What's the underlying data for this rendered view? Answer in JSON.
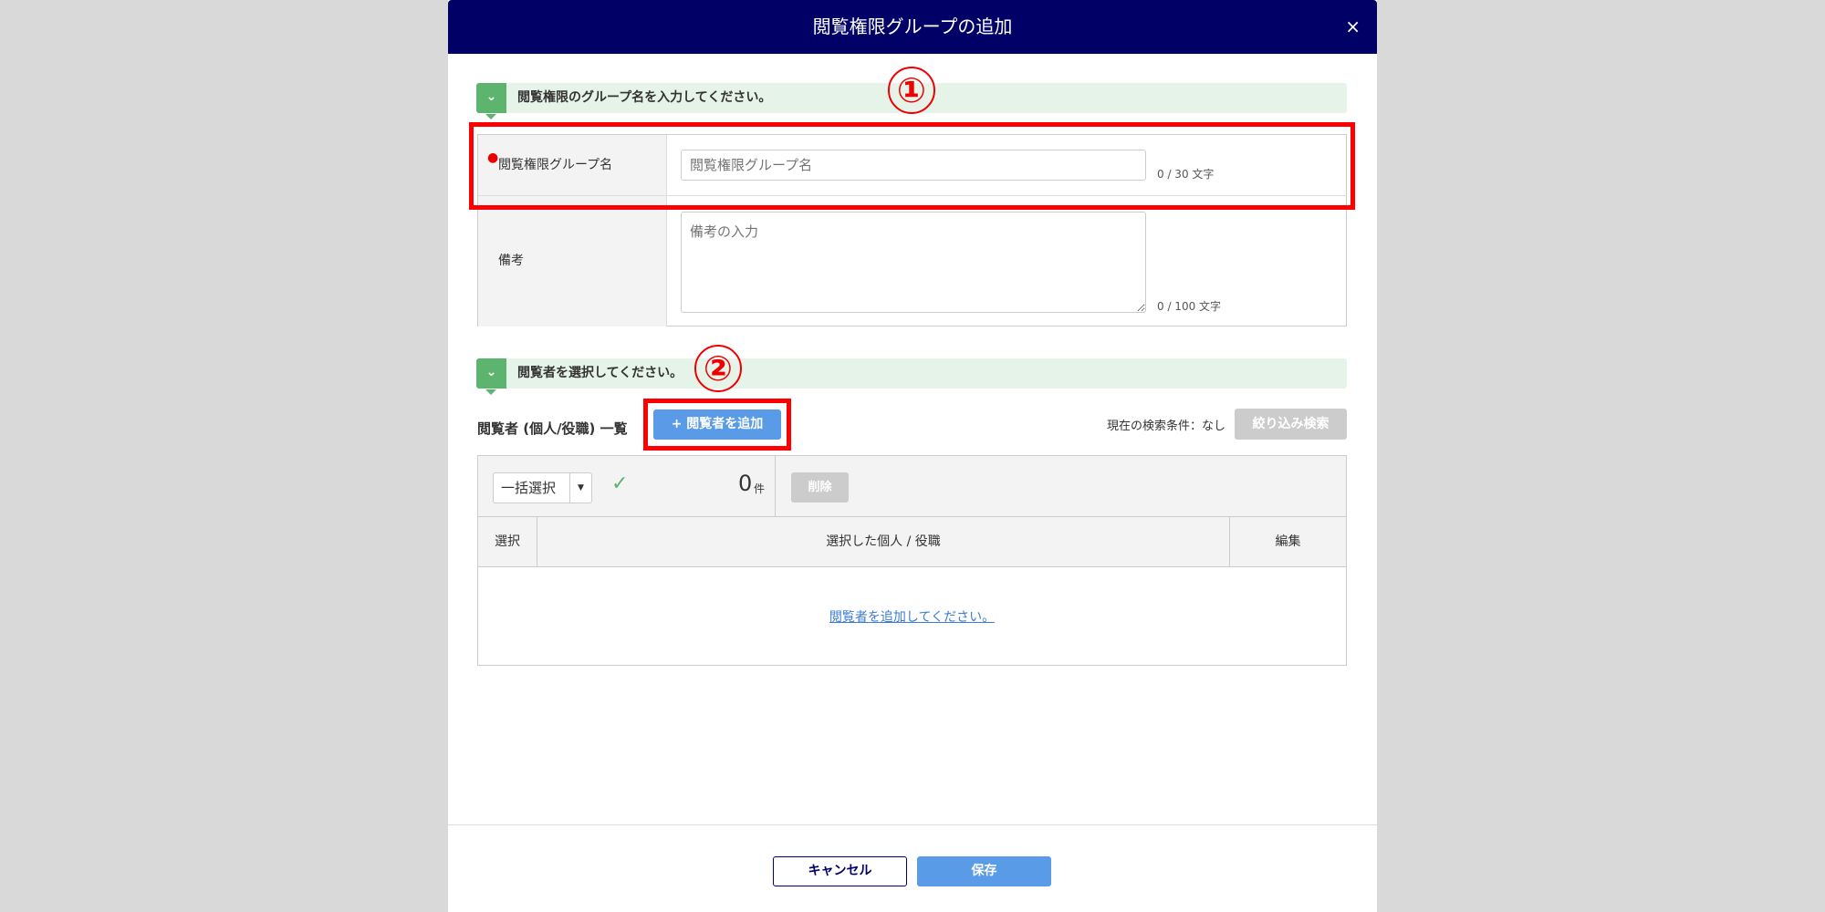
{
  "dialog": {
    "title": "閲覧権限グループの追加",
    "close_label": "×"
  },
  "section1": {
    "heading": "閲覧権限のグループ名を入力してください。",
    "marker": "①",
    "name_label": "閲覧権限グループ名",
    "name_placeholder": "閲覧権限グループ名",
    "name_count": "0 / 30 文字",
    "note_label": "備考",
    "note_placeholder": "備考の入力",
    "note_count": "0 / 100 文字"
  },
  "section2": {
    "heading": "閲覧者を選択してください。",
    "marker": "②",
    "list_title": "閲覧者 (個人/役職) 一覧",
    "add_button": "+ 閲覧者を追加",
    "search_condition": "現在の検索条件：なし",
    "filter_button": "絞り込み検索",
    "bulk_select": "一括選択",
    "count": "0",
    "count_unit": "件",
    "delete_button": "削除",
    "columns": [
      "選択",
      "選択した個人 / 役職",
      "編集"
    ],
    "empty_link": "閲覧者を追加してください。"
  },
  "footer": {
    "cancel": "キャンセル",
    "save": "保存"
  },
  "colors": {
    "header": "#000066",
    "accent": "#5a9be8",
    "section": "#5cb46e",
    "highlight": "#ff0000"
  }
}
